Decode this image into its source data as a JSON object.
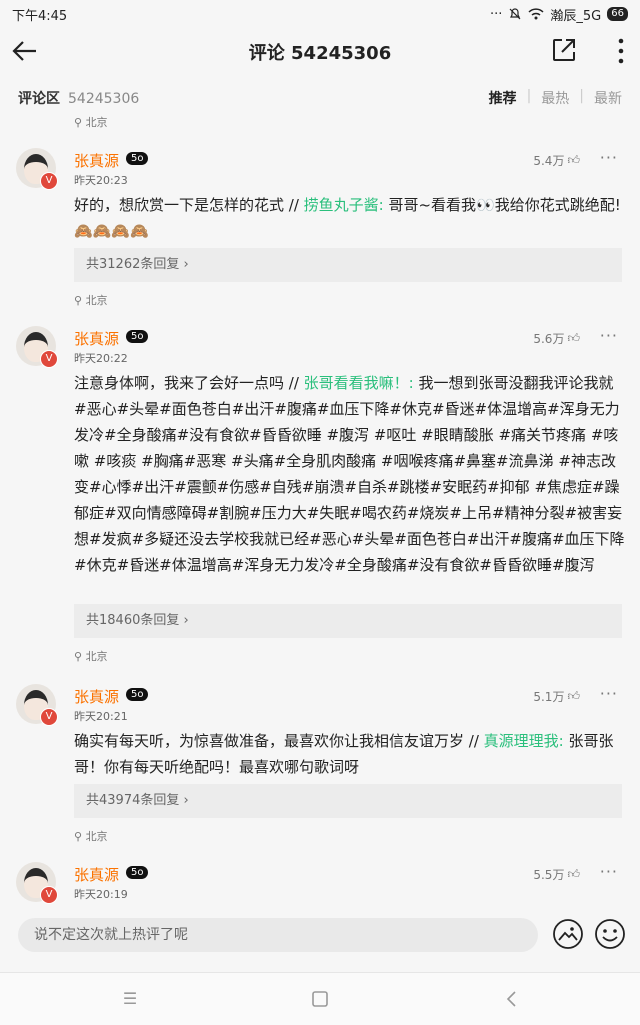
{
  "status_bar": {
    "time": "下午4:45",
    "icons": "··· ",
    "network": "瀚辰_5G",
    "battery": "66"
  },
  "header": {
    "title": "评论 54245306"
  },
  "sub_header": {
    "label": "评论区",
    "count": "54245306",
    "sort_options": [
      "推荐",
      "最热",
      "最新"
    ],
    "separator": "|"
  },
  "top_location": "北京",
  "comments": [
    {
      "user": "张真源",
      "level": "5o",
      "vip_badge": "V",
      "time": "昨天20:23",
      "likes": "5.4万",
      "more": "···",
      "text_before": "好的，想欣赏一下是怎样的花式 // ",
      "quote": "捞鱼丸子酱:",
      "text_after": " 哥哥~看看我👀我给你花式跳绝配!🙈🙈🙈🙈",
      "replies": "共31262条回复 ›",
      "location": "北京"
    },
    {
      "user": "张真源",
      "level": "5o",
      "vip_badge": "V",
      "time": "昨天20:22",
      "likes": "5.6万",
      "more": "···",
      "text_before": "注意身体啊，我来了会好一点吗 // ",
      "quote": "张哥看看我嘛！:",
      "text_after": " 我一想到张哥没翻我评论我就#恶心#头晕#面色苍白#出汗#腹痛#血压下降#休克#昏迷#体温增高#浑身无力发冷#全身酸痛#没有食欲#昏昏欲睡 #腹泻 #呕吐 #眼睛酸胀 #痛关节疼痛 #咳嗽 #咳痰 #胸痛#恶寒 #头痛#全身肌肉酸痛 #咽喉疼痛#鼻塞#流鼻涕 #神志改变#心悸#出汗#震颤#伤感#自残#崩溃#自杀#跳楼#安眠药#抑郁 #焦虑症#躁郁症#双向情感障碍#割腕#压力大#失眠#喝农药#烧炭#上吊#精神分裂#被害妄想#发疯#多疑还没去学校我就已经#恶心#头晕#面色苍白#出汗#腹痛#血压下降#休克#昏迷#体温增高#浑身无力发冷#全身酸痛#没有食欲#昏昏欲睡#腹泻",
      "replies": "共18460条回复 ›",
      "location": "北京"
    },
    {
      "user": "张真源",
      "level": "5o",
      "vip_badge": "V",
      "time": "昨天20:21",
      "likes": "5.1万",
      "more": "···",
      "text_before": "确实有每天听，为惊喜做准备，最喜欢你让我相信友谊万岁 // ",
      "quote": "真源理理我:",
      "text_after": " 张哥张哥！你有每天听绝配吗！最喜欢哪句歌词呀",
      "replies": "共43974条回复 ›",
      "location": "北京"
    },
    {
      "user": "张真源",
      "level": "5o",
      "vip_badge": "V",
      "time": "昨天20:19",
      "likes": "5.5万",
      "more": "···"
    }
  ],
  "input": {
    "placeholder": "说不定这次就上热评了呢"
  },
  "nav_icons": [
    "menu-icon",
    "home-square-icon",
    "back-triangle-icon"
  ]
}
